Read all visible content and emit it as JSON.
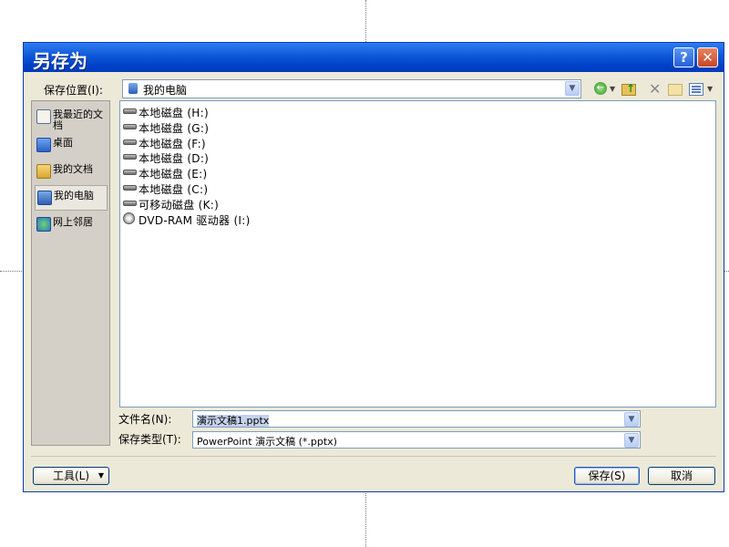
{
  "dialog": {
    "title": "另存为",
    "help_glyph": "?",
    "close_glyph": "✕"
  },
  "location": {
    "label": "保存位置(I):",
    "value": "我的电脑"
  },
  "toolbar": {
    "icons": [
      "back-icon",
      "up-folder-icon",
      "delete-icon",
      "new-folder-icon",
      "views-icon"
    ]
  },
  "places": [
    {
      "label": "我最近的文档",
      "icon": "recent-docs-icon"
    },
    {
      "label": "桌面",
      "icon": "desktop-icon"
    },
    {
      "label": "我的文档",
      "icon": "my-documents-icon"
    },
    {
      "label": "我的电脑",
      "icon": "my-computer-icon",
      "selected": true
    },
    {
      "label": "网上邻居",
      "icon": "network-places-icon"
    }
  ],
  "drives": [
    {
      "name": "本地磁盘 (H:)",
      "icon": "hard-drive-icon"
    },
    {
      "name": "本地磁盘 (G:)",
      "icon": "hard-drive-icon"
    },
    {
      "name": "本地磁盘 (F:)",
      "icon": "hard-drive-icon"
    },
    {
      "name": "本地磁盘 (D:)",
      "icon": "hard-drive-icon"
    },
    {
      "name": "本地磁盘 (E:)",
      "icon": "hard-drive-icon"
    },
    {
      "name": "本地磁盘 (C:)",
      "icon": "hard-drive-icon"
    },
    {
      "name": "可移动磁盘 (K:)",
      "icon": "removable-drive-icon"
    },
    {
      "name": "DVD-RAM 驱动器 (I:)",
      "icon": "dvd-drive-icon"
    }
  ],
  "filename": {
    "label": "文件名(N):",
    "value": "演示文稿1.pptx"
  },
  "filetype": {
    "label": "保存类型(T):",
    "value": "PowerPoint 演示文稿 (*.pptx)"
  },
  "buttons": {
    "tools": "工具(L)",
    "save": "保存(S)",
    "cancel": "取消"
  },
  "colors": {
    "title_bar": "#0e58d8",
    "dialog_bg": "#ece9d8",
    "selection": "#c5d2ec"
  }
}
